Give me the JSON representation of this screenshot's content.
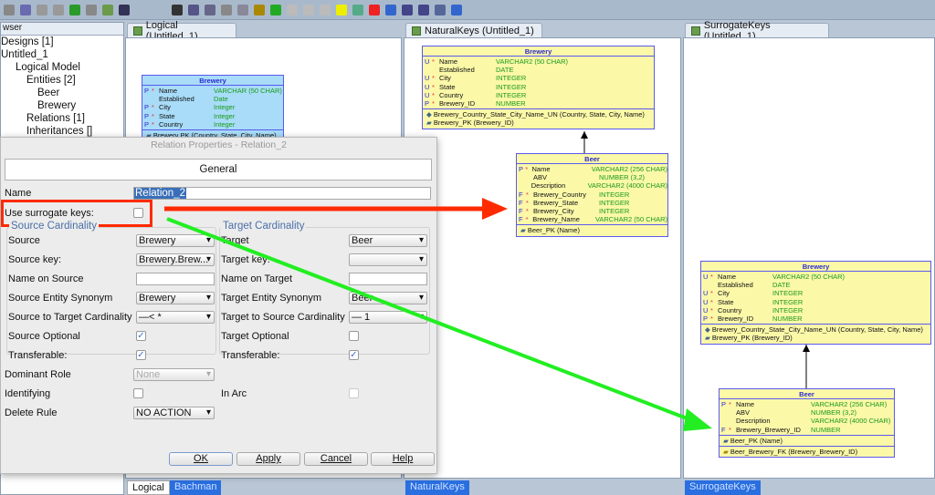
{
  "toolbar": {
    "icons": [
      "save-icon",
      "save-all-icon",
      "undo-icon",
      "redo-icon",
      "back-icon",
      "forward-icon",
      "engineer-icon",
      "find-icon",
      "select-icon",
      "new-entity-icon",
      "new-view-icon",
      "new-relation-icon",
      "key-icon",
      "arrow-icon",
      "note-icon",
      "picture-icon",
      "delete-icon",
      "collapse-icon",
      "zoom-in-icon",
      "zoom-out-icon",
      "fit-icon",
      "layout-icon",
      "search-icon",
      "page-icon",
      "back-arrow-icon",
      "forward-arrow-icon"
    ]
  },
  "browser": {
    "title": "wser",
    "tree": [
      {
        "label": "Designs [1]",
        "level": 0
      },
      {
        "label": "Untitled_1",
        "level": 0
      },
      {
        "label": "Logical Model",
        "level": 1
      },
      {
        "label": "Entities [2]",
        "level": 2
      },
      {
        "label": "Beer",
        "level": 3
      },
      {
        "label": "Brewery",
        "level": 3
      },
      {
        "label": "Relations [1]",
        "level": 2
      },
      {
        "label": "Inheritances []",
        "level": 2
      }
    ]
  },
  "tabs": {
    "logical": "Logical (Untitled_1)",
    "natural": "NaturalKeys (Untitled_1)",
    "surrogate": "SurrogateKeys (Untitled_1)"
  },
  "bottom_tabs": {
    "logical": "Logical",
    "bachman": "Bachman",
    "natural": "NaturalKeys",
    "surrogate": "SurrogateKeys"
  },
  "entities": {
    "logical_brewery": {
      "title": "Brewery",
      "color": "#a8dcf8",
      "cols": [
        [
          "P",
          "*",
          "Name",
          "VARCHAR (50 CHAR)"
        ],
        [
          "",
          "",
          "Established",
          "Date"
        ],
        [
          "P",
          "*",
          "City",
          "Integer"
        ],
        [
          "P",
          "*",
          "State",
          "Integer"
        ],
        [
          "P",
          "*",
          "Country",
          "Integer"
        ]
      ],
      "keys": [
        [
          "pk-icon",
          "Brewery PK (Country, State, City, Name)"
        ]
      ]
    },
    "nk_brewery": {
      "title": "Brewery",
      "color": "#fbf8a8",
      "cols": [
        [
          "U",
          "*",
          "Name",
          "VARCHAR2 (50 CHAR)"
        ],
        [
          "",
          "",
          "Established",
          "DATE"
        ],
        [
          "U",
          "*",
          "City",
          "INTEGER"
        ],
        [
          "U",
          "*",
          "State",
          "INTEGER"
        ],
        [
          "U",
          "*",
          "Country",
          "INTEGER"
        ],
        [
          "P",
          "*",
          "Brewery_ID",
          "NUMBER"
        ]
      ],
      "keys": [
        [
          "unique-key-icon",
          "Brewery_Country_State_City_Name_UN (Country, State, City, Name)"
        ],
        [
          "pk-icon",
          "Brewery_PK (Brewery_ID)"
        ]
      ]
    },
    "nk_beer": {
      "title": "Beer",
      "color": "#fbf8a8",
      "cols": [
        [
          "P",
          "*",
          "Name",
          "VARCHAR2 (256 CHAR)"
        ],
        [
          "",
          "",
          "ABV",
          "NUMBER (3,2)"
        ],
        [
          "",
          "",
          "Description",
          "VARCHAR2 (4000 CHAR)"
        ],
        [
          "F",
          "*",
          "Brewery_Country",
          "INTEGER"
        ],
        [
          "F",
          "*",
          "Brewery_State",
          "INTEGER"
        ],
        [
          "F",
          "*",
          "Brewery_City",
          "INTEGER"
        ],
        [
          "F",
          "*",
          "Brewery_Name",
          "VARCHAR2 (50 CHAR)"
        ]
      ],
      "keys": [
        [
          "pk-icon",
          "Beer_PK (Name)"
        ]
      ]
    },
    "sk_brewery": {
      "title": "Brewery",
      "color": "#fbf8a8",
      "cols": [
        [
          "U",
          "*",
          "Name",
          "VARCHAR2 (50 CHAR)"
        ],
        [
          "",
          "",
          "Established",
          "DATE"
        ],
        [
          "U",
          "*",
          "City",
          "INTEGER"
        ],
        [
          "U",
          "*",
          "State",
          "INTEGER"
        ],
        [
          "U",
          "*",
          "Country",
          "INTEGER"
        ],
        [
          "P",
          "*",
          "Brewery_ID",
          "NUMBER"
        ]
      ],
      "keys": [
        [
          "unique-key-icon",
          "Brewery_Country_State_City_Name_UN (Country, State, City, Name)"
        ],
        [
          "pk-icon",
          "Brewery_PK (Brewery_ID)"
        ]
      ]
    },
    "sk_beer": {
      "title": "Beer",
      "color": "#fbf8a8",
      "cols": [
        [
          "P",
          "*",
          "Name",
          "VARCHAR2 (256 CHAR)"
        ],
        [
          "",
          "",
          "ABV",
          "NUMBER (3,2)"
        ],
        [
          "",
          "",
          "Description",
          "VARCHAR2 (4000 CHAR)"
        ],
        [
          "F",
          "*",
          "Brewery_Brewery_ID",
          "NUMBER"
        ]
      ],
      "keys": [
        [
          "pk-icon",
          "Beer_PK (Name)"
        ]
      ],
      "fks": [
        [
          "fk-icon",
          "Beer_Brewery_FK (Brewery_Brewery_ID)"
        ]
      ]
    }
  },
  "dialog": {
    "title": "Relation Properties - Relation_2",
    "section": "General",
    "name_label": "Name",
    "name_value": "Relation_2",
    "surrogate_label": "Use surrogate keys:",
    "surrogate_checked": false,
    "source": {
      "title": "Source Cardinality",
      "source_label": "Source",
      "source_value": "Brewery",
      "key_label": "Source key:",
      "key_value": "Brewery.Brew...",
      "name_label": "Name on Source",
      "name_value": "",
      "synonym_label": "Source Entity Synonym",
      "synonym_value": "Brewery",
      "card_label": "Source to Target Cardinality",
      "card_value": "—< *",
      "optional_label": "Source Optional",
      "optional": true,
      "transfer_label": "Transferable:",
      "transfer": true
    },
    "target": {
      "title": "Target Cardinality",
      "target_label": "Target",
      "target_value": "Beer",
      "key_label": "Target key:",
      "key_value": "",
      "name_label": "Name on Target",
      "name_value": "",
      "synonym_label": "Target Entity Synonym",
      "synonym_value": "Beer",
      "card_label": "Target to Source Cardinality",
      "card_value": "— 1",
      "optional_label": "Target Optional",
      "optional": false,
      "transfer_label": "Transferable:",
      "transfer": true
    },
    "dominant_label": "Dominant Role",
    "dominant_value": "None",
    "identifying_label": "Identifying",
    "identifying": false,
    "inarc_label": "In Arc",
    "inarc": false,
    "delete_label": "Delete Rule",
    "delete_value": "NO ACTION",
    "buttons": {
      "ok": "OK",
      "apply": "Apply",
      "cancel": "Cancel",
      "help": "Help"
    }
  },
  "colors": {
    "highlight": "#ff2a00",
    "arrow_green": "#22ee22",
    "tab_selected": "#2a6fe0"
  }
}
